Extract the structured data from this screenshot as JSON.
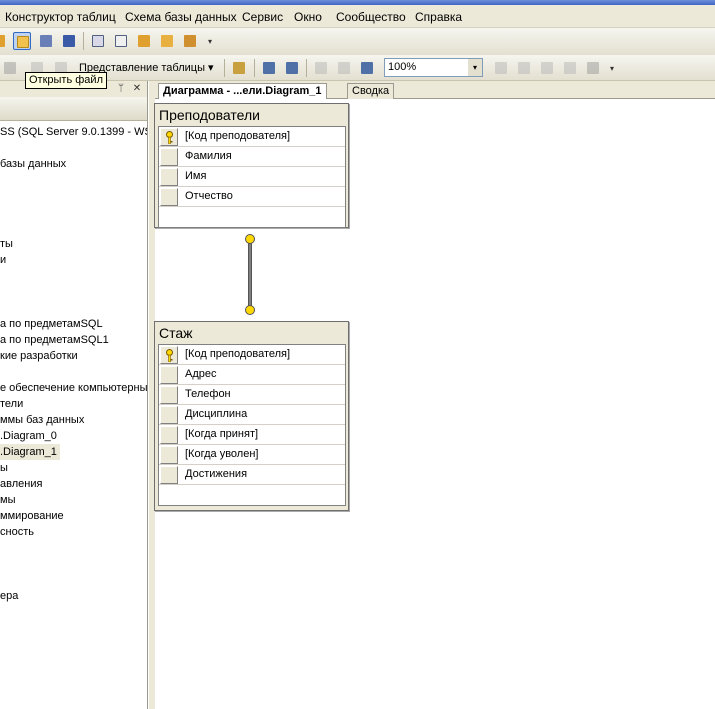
{
  "menu": [
    "Конструктор таблиц",
    "Схема базы данных",
    "Сервис",
    "Окно",
    "Сообщество",
    "Справка"
  ],
  "toolbar": {
    "table_view_label": "Представление таблицы",
    "table_view_arrow": "▾",
    "zoom_value": "100%",
    "zoom_arrow": "▾",
    "overflow": "▾"
  },
  "tooltip": "Открыть файл",
  "panel": {
    "pin": "ᛘ",
    "close": "✕",
    "tree": [
      "SS (SQL Server 9.0.1399 - WS",
      "базы данных",
      "ты",
      "и",
      "а по предметамSQL",
      "а по предметамSQL1",
      "кие разработки",
      "е обеспечение компьютерны",
      "тели",
      "ммы баз данных",
      ".Diagram_0",
      ".Diagram_1",
      "ы",
      "авления",
      "мы",
      "ммирование",
      "сность",
      "ера"
    ]
  },
  "tabs": {
    "active": "Диаграмма - ...ели.Diagram_1",
    "inactive": "Сводка"
  },
  "tables": [
    {
      "title": "Преподователи",
      "columns": [
        {
          "name": "[Код преподователя]",
          "key": true
        },
        {
          "name": "Фамилия",
          "key": false
        },
        {
          "name": "Имя",
          "key": false
        },
        {
          "name": "Отчество",
          "key": false
        }
      ]
    },
    {
      "title": "Стаж",
      "columns": [
        {
          "name": "[Код преподователя]",
          "key": true
        },
        {
          "name": "Адрес",
          "key": false
        },
        {
          "name": "Телефон",
          "key": false
        },
        {
          "name": "Дисциплина",
          "key": false
        },
        {
          "name": "[Когда принят]",
          "key": false
        },
        {
          "name": "[Когда уволен]",
          "key": false
        },
        {
          "name": "Достижения",
          "key": false
        }
      ]
    }
  ],
  "icons": {
    "key": "key-icon",
    "relationship_end": "relationship-key-icon"
  },
  "colors": {
    "chrome": "#ece9d8",
    "key_gold": "#ffd800",
    "tooltip_bg": "#ffffe1"
  }
}
